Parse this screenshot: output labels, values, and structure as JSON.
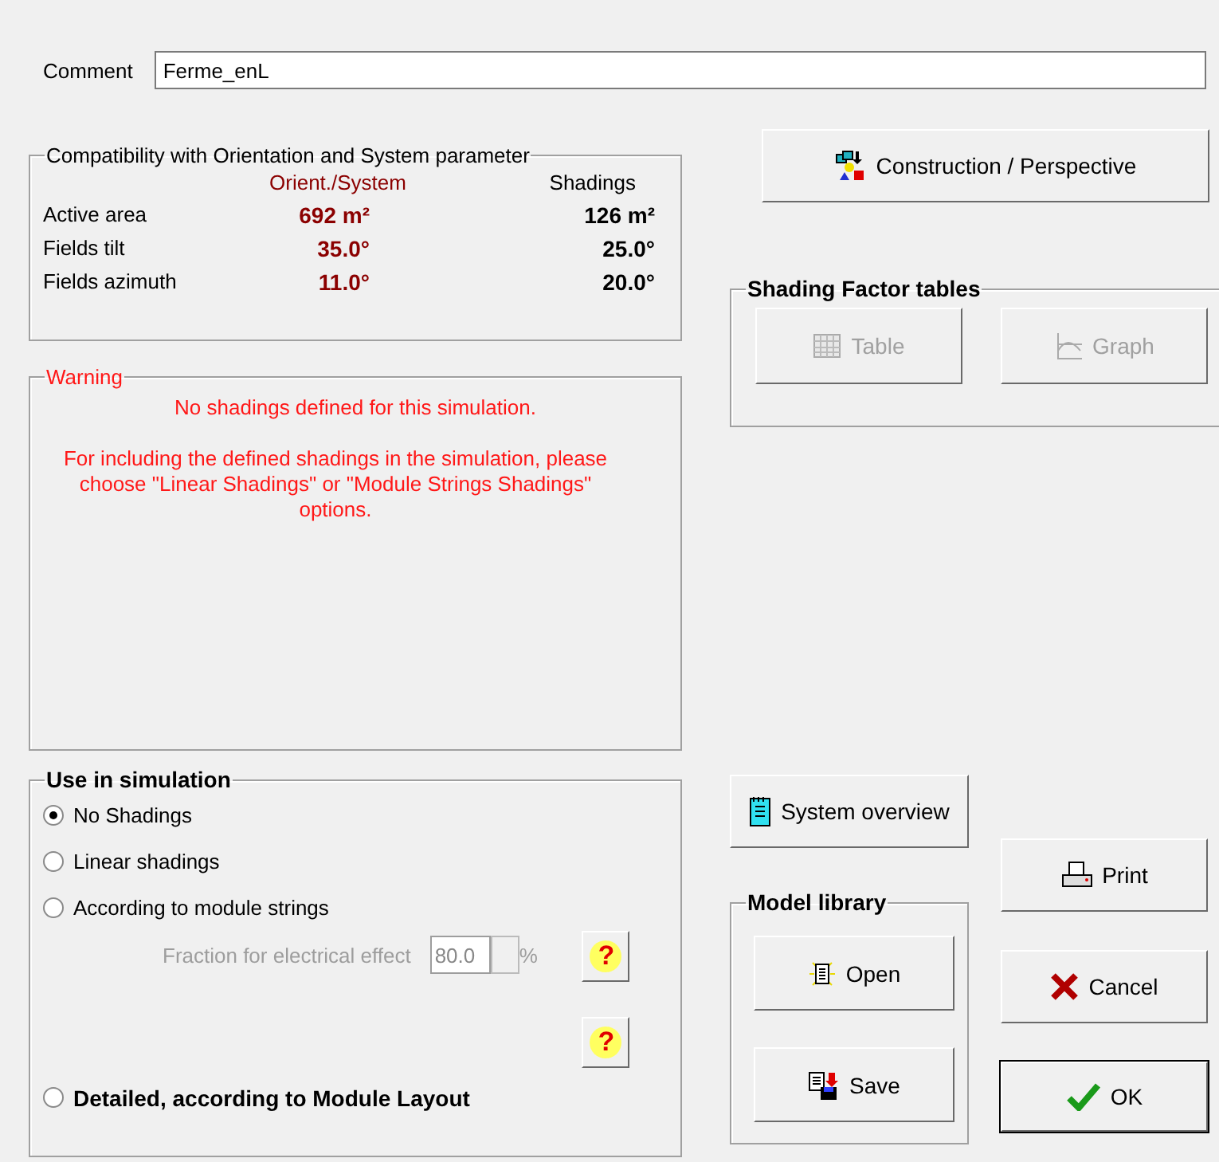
{
  "comment": {
    "label": "Comment",
    "value": "Ferme_enL"
  },
  "compatibility": {
    "title": "Compatibility with Orientation and System parameter",
    "columns": [
      "Orient./System",
      "Shadings"
    ],
    "rows": [
      {
        "label": "Active area",
        "orient": "692 m²",
        "shadings": "126 m²"
      },
      {
        "label": "Fields tilt",
        "orient": "35.0°",
        "shadings": "25.0°"
      },
      {
        "label": "Fields azimuth",
        "orient": "11.0°",
        "shadings": "20.0°"
      }
    ]
  },
  "warning": {
    "title": "Warning",
    "message": "No shadings defined for this simulation.",
    "details": "For including the defined shadings in the simulation, please choose \"Linear Shadings\" or \"Module Strings Shadings\" options."
  },
  "use_in_simulation": {
    "title": "Use in simulation",
    "options": [
      {
        "label": "No Shadings",
        "selected": true,
        "bold": false
      },
      {
        "label": "Linear shadings",
        "selected": false,
        "bold": false
      },
      {
        "label": "According to module strings",
        "selected": false,
        "bold": false
      },
      {
        "label": "Detailed, according to Module Layout",
        "selected": false,
        "bold": true
      }
    ],
    "fraction": {
      "label": "Fraction for electrical effect",
      "value": "80.0",
      "unit": "%",
      "disabled": true
    },
    "help_buttons": [
      {
        "label": "?"
      },
      {
        "label": "?"
      }
    ]
  },
  "construction_button": {
    "label": "Construction / Perspective"
  },
  "shading_factor_tables": {
    "title": "Shading Factor tables",
    "buttons": [
      {
        "label": "Table",
        "kind": "table",
        "disabled": true
      },
      {
        "label": "Graph",
        "kind": "graph",
        "disabled": true
      }
    ]
  },
  "system_overview_button": {
    "label": "System overview"
  },
  "model_library": {
    "title": "Model library",
    "buttons": [
      {
        "label": "Open",
        "kind": "open"
      },
      {
        "label": "Save",
        "kind": "save"
      }
    ]
  },
  "dialog_buttons": [
    {
      "label": "Print",
      "kind": "print",
      "default": false
    },
    {
      "label": "Cancel",
      "kind": "cancel",
      "default": false
    },
    {
      "label": "OK",
      "kind": "ok",
      "default": true
    }
  ]
}
